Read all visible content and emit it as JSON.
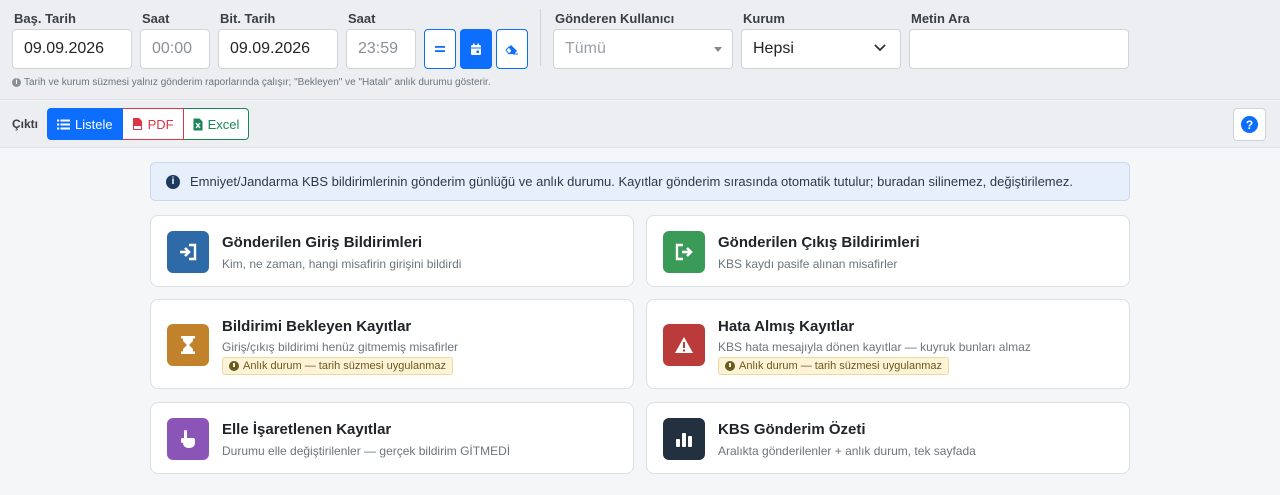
{
  "filters": {
    "start_date": {
      "label": "Baş. Tarih",
      "value": "09.09.2026"
    },
    "start_time": {
      "label": "Saat",
      "value": "00:00"
    },
    "end_date": {
      "label": "Bit. Tarih",
      "value": "09.09.2026"
    },
    "end_time": {
      "label": "Saat",
      "value": "23:59"
    },
    "sender_user": {
      "label": "Gönderen Kullanıcı",
      "value": "Tümü"
    },
    "institution": {
      "label": "Kurum",
      "value": "Hepsi"
    },
    "text_search": {
      "label": "Metin Ara",
      "value": ""
    },
    "hint": "Tarih ve kurum süzmesi yalnız gönderim raporlarında çalışır; \"Bekleyen\" ve \"Hatalı\" anlık durumu gösterir.",
    "icons": [
      "equals-icon",
      "calendar-icon",
      "eraser-icon"
    ]
  },
  "output": {
    "label": "Çıktı",
    "buttons": [
      {
        "label": "Listele",
        "icon": "list-icon",
        "active": true
      },
      {
        "label": "PDF",
        "icon": "file-pdf-icon",
        "active": false
      },
      {
        "label": "Excel",
        "icon": "file-excel-icon",
        "active": false
      }
    ],
    "help_icon": "question-circle-icon"
  },
  "info_alert": "Emniyet/Jandarma KBS bildirimlerinin gönderim günlüğü ve anlık durumu. Kayıtlar gönderim sırasında otomatik tutulur; buradan silinemez, değiştirilemez.",
  "reports": [
    {
      "title": "Gönderilen Giriş Bildirimleri",
      "subtitle": "Kim, ne zaman, hangi misafirin girişini bildirdi",
      "badge": "",
      "icon": "sign-in-icon",
      "color": "#2f6aa8"
    },
    {
      "title": "Gönderilen Çıkış Bildirimleri",
      "subtitle": "KBS kaydı pasife alınan misafirler",
      "badge": "",
      "icon": "sign-out-icon",
      "color": "#3a9a58"
    },
    {
      "title": "Bildirimi Bekleyen Kayıtlar",
      "subtitle": "Giriş/çıkış bildirimi henüz gitmemiş misafirler",
      "badge": "Anlık durum — tarih süzmesi uygulanmaz",
      "icon": "hourglass-icon",
      "color": "#c2812b"
    },
    {
      "title": "Hata Almış Kayıtlar",
      "subtitle": "KBS hata mesajıyla dönen kayıtlar — kuyruk bunları almaz",
      "badge": "Anlık durum — tarih süzmesi uygulanmaz",
      "icon": "warning-icon",
      "color": "#bb3b3b"
    },
    {
      "title": "Elle İşaretlenen Kayıtlar",
      "subtitle": "Durumu elle değiştirilenler — gerçek bildirim GİTMEDİ",
      "badge": "",
      "icon": "hand-pointer-icon",
      "color": "#8b55b8"
    },
    {
      "title": "KBS Gönderim Özeti",
      "subtitle": "Aralıkta gönderilenler + anlık durum, tek sayfada",
      "badge": "",
      "icon": "bar-chart-icon",
      "color": "#22303f"
    }
  ]
}
